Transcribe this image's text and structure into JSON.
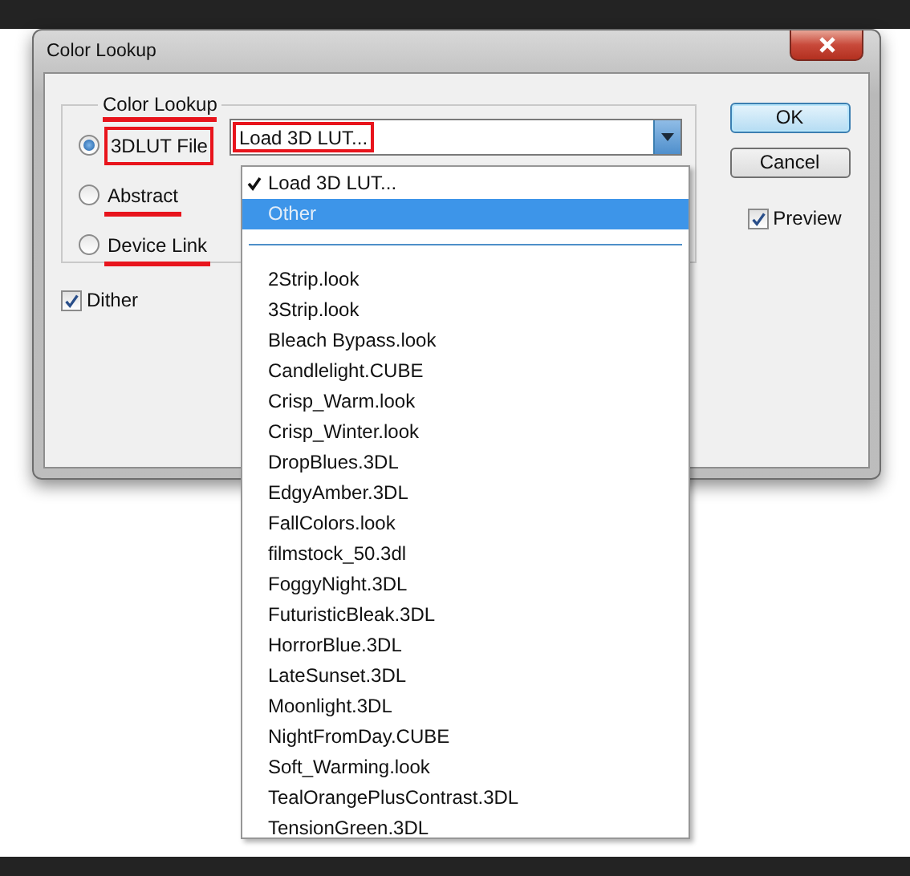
{
  "window": {
    "title": "Color Lookup"
  },
  "group": {
    "title": "Color Lookup",
    "underlined": true,
    "boxed": false
  },
  "sources": [
    {
      "label": "3DLUT File",
      "selected": true,
      "underlined": false,
      "boxed": true
    },
    {
      "label": "Abstract",
      "selected": false,
      "underlined": true,
      "boxed": false
    },
    {
      "label": "Device Link",
      "selected": false,
      "underlined": true,
      "boxed": false
    }
  ],
  "lut_select": {
    "value": "Load 3D LUT...",
    "underlined": false,
    "boxed": true,
    "expanded": true
  },
  "dither": {
    "label": "Dither",
    "checked": true
  },
  "buttons": [
    {
      "label": "OK",
      "default": true
    },
    {
      "label": "Cancel",
      "default": false
    }
  ],
  "preview": {
    "label": "Preview",
    "checked": true
  },
  "menu": {
    "items": [
      {
        "kind": "option",
        "label": "Load 3D LUT...",
        "checked": true,
        "highlighted": false,
        "disabled": false
      },
      {
        "kind": "option",
        "label": "Other",
        "checked": false,
        "highlighted": true,
        "disabled": true
      },
      {
        "kind": "separator"
      },
      {
        "kind": "option",
        "label": "2Strip.look",
        "checked": false,
        "highlighted": false,
        "disabled": false
      },
      {
        "kind": "option",
        "label": "3Strip.look",
        "checked": false,
        "highlighted": false,
        "disabled": false
      },
      {
        "kind": "option",
        "label": "Bleach Bypass.look",
        "checked": false,
        "highlighted": false,
        "disabled": false
      },
      {
        "kind": "option",
        "label": "Candlelight.CUBE",
        "checked": false,
        "highlighted": false,
        "disabled": false
      },
      {
        "kind": "option",
        "label": "Crisp_Warm.look",
        "checked": false,
        "highlighted": false,
        "disabled": false
      },
      {
        "kind": "option",
        "label": "Crisp_Winter.look",
        "checked": false,
        "highlighted": false,
        "disabled": false
      },
      {
        "kind": "option",
        "label": "DropBlues.3DL",
        "checked": false,
        "highlighted": false,
        "disabled": false
      },
      {
        "kind": "option",
        "label": "EdgyAmber.3DL",
        "checked": false,
        "highlighted": false,
        "disabled": false
      },
      {
        "kind": "option",
        "label": "FallColors.look",
        "checked": false,
        "highlighted": false,
        "disabled": false
      },
      {
        "kind": "option",
        "label": "filmstock_50.3dl",
        "checked": false,
        "highlighted": false,
        "disabled": false
      },
      {
        "kind": "option",
        "label": "FoggyNight.3DL",
        "checked": false,
        "highlighted": false,
        "disabled": false
      },
      {
        "kind": "option",
        "label": "FuturisticBleak.3DL",
        "checked": false,
        "highlighted": false,
        "disabled": false
      },
      {
        "kind": "option",
        "label": "HorrorBlue.3DL",
        "checked": false,
        "highlighted": false,
        "disabled": false
      },
      {
        "kind": "option",
        "label": "LateSunset.3DL",
        "checked": false,
        "highlighted": false,
        "disabled": false
      },
      {
        "kind": "option",
        "label": "Moonlight.3DL",
        "checked": false,
        "highlighted": false,
        "disabled": false
      },
      {
        "kind": "option",
        "label": "NightFromDay.CUBE",
        "checked": false,
        "highlighted": false,
        "disabled": false
      },
      {
        "kind": "option",
        "label": "Soft_Warming.look",
        "checked": false,
        "highlighted": false,
        "disabled": false
      },
      {
        "kind": "option",
        "label": "TealOrangePlusContrast.3DL",
        "checked": false,
        "highlighted": false,
        "disabled": false
      },
      {
        "kind": "option",
        "label": "TensionGreen.3DL",
        "checked": false,
        "highlighted": false,
        "disabled": false
      }
    ]
  }
}
